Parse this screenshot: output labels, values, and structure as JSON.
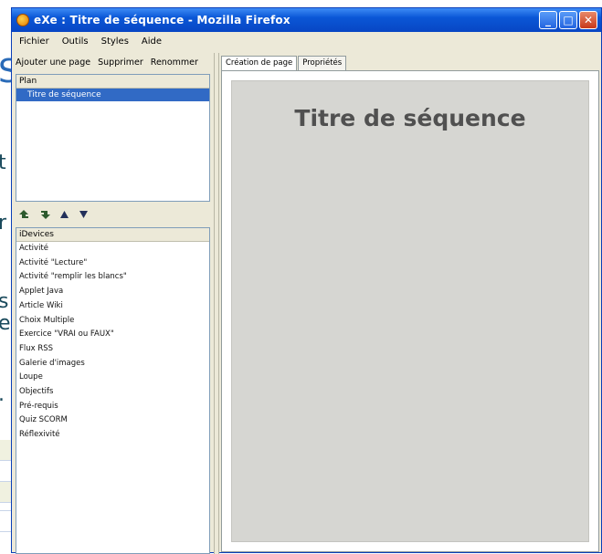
{
  "background": {
    "big_fragment": "S",
    "fragments": [
      "t",
      "r",
      "s",
      "e",
      "."
    ]
  },
  "window": {
    "title": "eXe : Titre de séquence - Mozilla Firefox",
    "controls": {
      "minimize": "_",
      "maximize": "□",
      "close": "✕"
    }
  },
  "menu": [
    "Fichier",
    "Outils",
    "Styles",
    "Aide"
  ],
  "toolbar": {
    "add_page": "Ajouter une page",
    "delete": "Supprimer",
    "rename": "Renommer"
  },
  "plan": {
    "header": "Plan",
    "selected_item": "Titre de séquence"
  },
  "devices": {
    "header": "iDevices",
    "items": [
      "Activité",
      "Activité \"Lecture\"",
      "Activité \"remplir les blancs\"",
      "Applet Java",
      "Article Wiki",
      "Choix Multiple",
      "Exercice \"VRAI ou FAUX\"",
      "Flux RSS",
      "Galerie d'images",
      "Loupe",
      "Objectifs",
      "Pré-requis",
      "Quiz SCORM",
      "Réflexivité"
    ]
  },
  "tabs": [
    "Création de page",
    "Propriétés"
  ],
  "page": {
    "title": "Titre de séquence"
  },
  "colors": {
    "titlebar": "#0a56d6",
    "selection": "#316ac5",
    "content_bg": "#d6d6d2"
  }
}
